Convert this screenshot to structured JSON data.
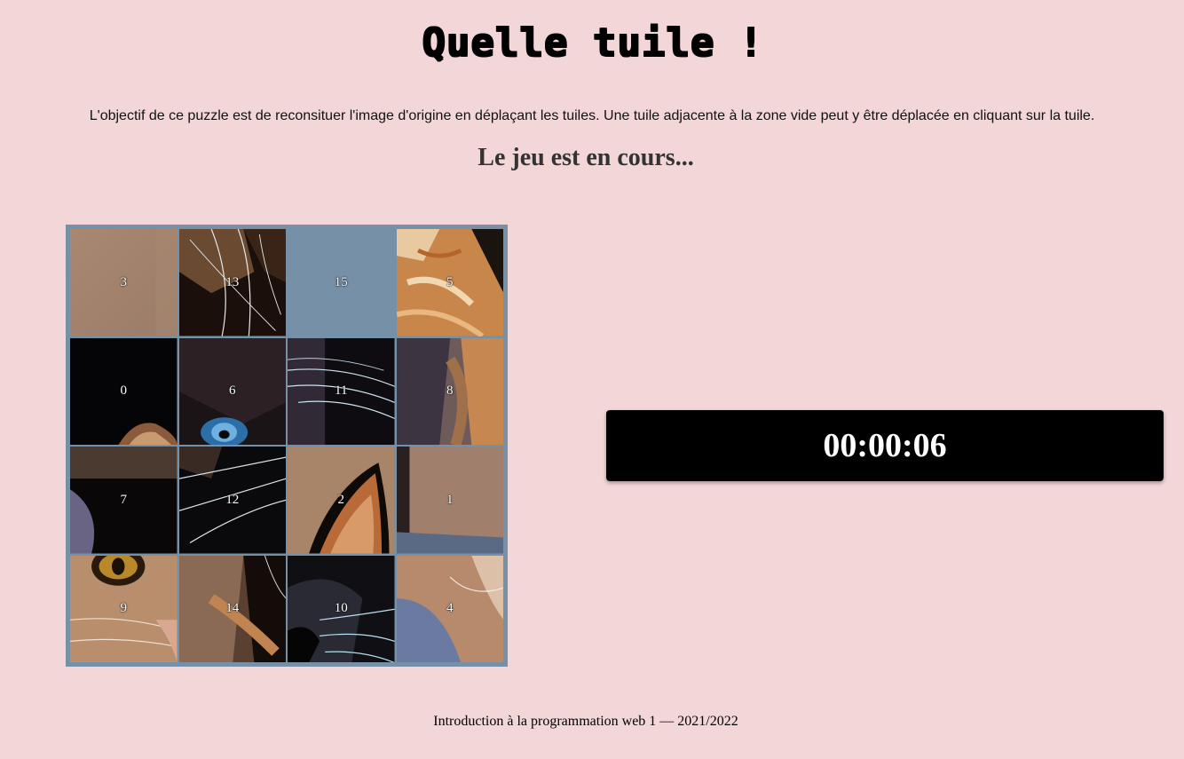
{
  "page": {
    "title": "Quelle tuile !",
    "intro": "L'objectif de ce puzzle est de reconsituer l'image d'origine en déplaçant les tuiles. Une tuile adjacente à la zone vide peut y être déplacée en cliquant sur la tuile.",
    "status": "Le jeu est en cours...",
    "footer": "Introduction à la programmation web 1 — 2021/2022"
  },
  "timer": {
    "value": "00:00:06"
  },
  "board": {
    "rows": 4,
    "cols": 4,
    "empty_tile": "15",
    "tiles": [
      "3",
      "13",
      "15",
      "5",
      "0",
      "6",
      "11",
      "8",
      "7",
      "12",
      "2",
      "1",
      "9",
      "14",
      "10",
      "4"
    ]
  },
  "colors": {
    "background": "#f2d6d8",
    "board_frame": "#7690a8",
    "timer_bg": "#000000",
    "timer_text": "#ffffff"
  }
}
